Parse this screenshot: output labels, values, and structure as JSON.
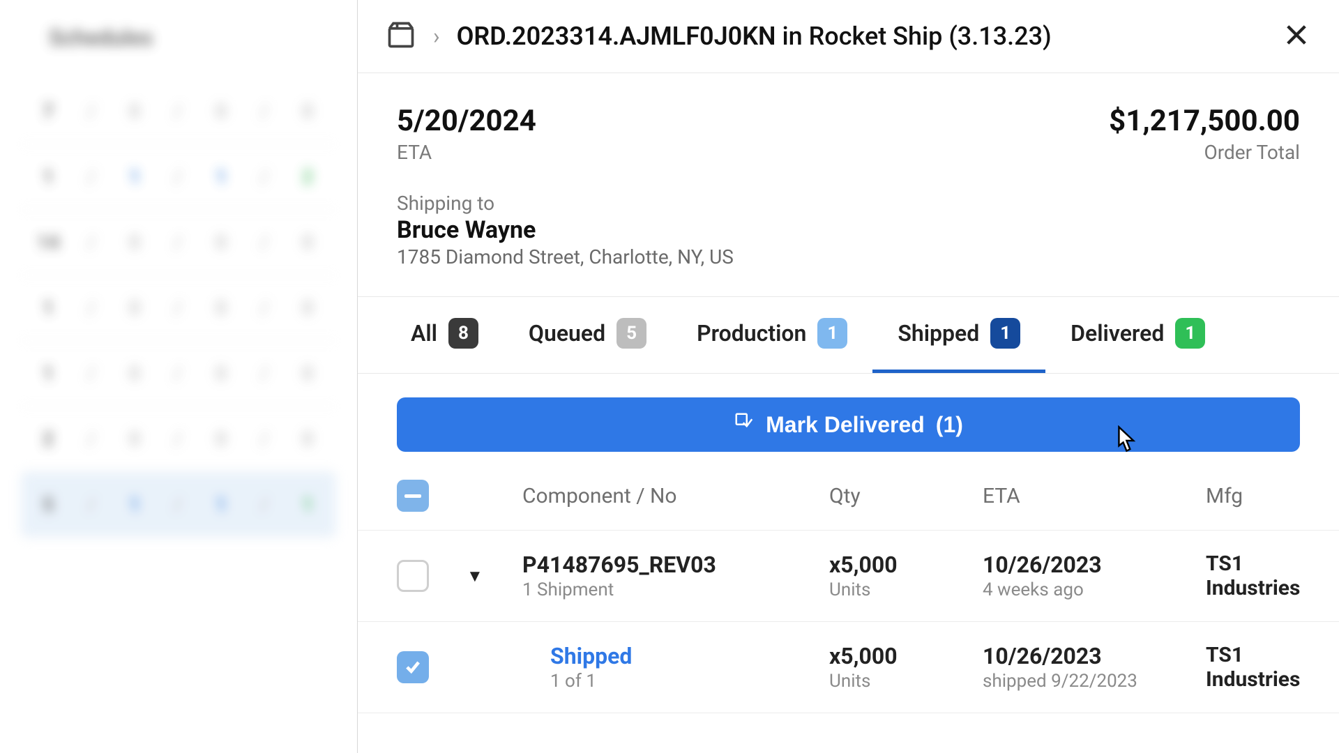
{
  "background": {
    "title": "Schedules",
    "rows": [
      [
        "7",
        "0",
        "0",
        "0"
      ],
      [
        "1",
        "1",
        "1",
        "2"
      ],
      [
        "14",
        "0",
        "0",
        "0"
      ],
      [
        "1",
        "0",
        "0",
        "0"
      ],
      [
        "1",
        "0",
        "0",
        "0"
      ],
      [
        "2",
        "0",
        "0",
        "0"
      ],
      [
        "5",
        "1",
        "1",
        "1"
      ]
    ]
  },
  "header": {
    "order_id": "ORD.2023314.AJMLF0J0KN",
    "in_label": "in",
    "project": "Rocket Ship (3.13.23)"
  },
  "summary": {
    "eta_value": "5/20/2024",
    "eta_label": "ETA",
    "total_value": "$1,217,500.00",
    "total_label": "Order Total"
  },
  "shipping": {
    "label": "Shipping to",
    "name": "Bruce Wayne",
    "address": "1785 Diamond Street, Charlotte, NY, US"
  },
  "tabs": {
    "all": {
      "label": "All",
      "count": "8"
    },
    "queued": {
      "label": "Queued",
      "count": "5"
    },
    "production": {
      "label": "Production",
      "count": "1"
    },
    "shipped": {
      "label": "Shipped",
      "count": "1"
    },
    "delivered": {
      "label": "Delivered",
      "count": "1"
    }
  },
  "action": {
    "label": "Mark Delivered",
    "count": "(1)"
  },
  "columns": {
    "component": "Component / No",
    "qty": "Qty",
    "eta": "ETA",
    "mfg": "Mfg"
  },
  "rows": [
    {
      "checked": false,
      "expand": true,
      "component": "P41487695_REV03",
      "component_sub": "1 Shipment",
      "component_link": false,
      "qty": "x5,000",
      "qty_sub": "Units",
      "eta": "10/26/2023",
      "eta_sub": "4 weeks ago",
      "mfg": "TS1 Industries"
    },
    {
      "checked": true,
      "expand": false,
      "component": "Shipped",
      "component_sub": "1 of 1",
      "component_link": true,
      "qty": "x5,000",
      "qty_sub": "Units",
      "eta": "10/26/2023",
      "eta_sub": "shipped 9/22/2023",
      "mfg": "TS1 Industries"
    }
  ]
}
